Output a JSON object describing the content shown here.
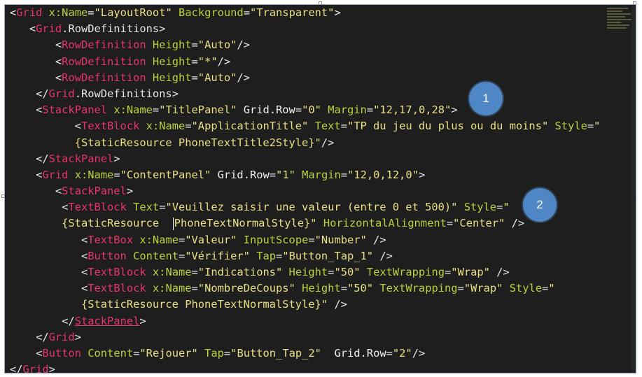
{
  "lines": [
    {
      "indent": "",
      "segs": [
        [
          "p",
          "<"
        ],
        [
          "t",
          "Grid"
        ],
        [
          "p",
          " "
        ],
        [
          "a",
          "x:Name"
        ],
        [
          "p",
          "="
        ],
        [
          "v",
          "\"LayoutRoot\""
        ],
        [
          "p",
          " "
        ],
        [
          "a",
          "Background"
        ],
        [
          "p",
          "="
        ],
        [
          "v",
          "\"Transparent\""
        ],
        [
          "p",
          ">"
        ]
      ]
    },
    {
      "indent": "   ",
      "segs": [
        [
          "p",
          "<"
        ],
        [
          "t",
          "Grid"
        ],
        [
          "p",
          ".RowDefinitions>"
        ]
      ]
    },
    {
      "indent": "       ",
      "segs": [
        [
          "p",
          "<"
        ],
        [
          "t",
          "RowDefinition"
        ],
        [
          "p",
          " "
        ],
        [
          "a",
          "Height"
        ],
        [
          "p",
          "="
        ],
        [
          "v",
          "\"Auto\""
        ],
        [
          "p",
          "/>"
        ]
      ]
    },
    {
      "indent": "       ",
      "segs": [
        [
          "p",
          "<"
        ],
        [
          "t",
          "RowDefinition"
        ],
        [
          "p",
          " "
        ],
        [
          "a",
          "Height"
        ],
        [
          "p",
          "="
        ],
        [
          "v",
          "\"*\""
        ],
        [
          "p",
          "/>"
        ]
      ]
    },
    {
      "indent": "       ",
      "segs": [
        [
          "p",
          "<"
        ],
        [
          "t",
          "RowDefinition"
        ],
        [
          "p",
          " "
        ],
        [
          "a",
          "Height"
        ],
        [
          "p",
          "="
        ],
        [
          "v",
          "\"Auto\""
        ],
        [
          "p",
          "/>"
        ]
      ]
    },
    {
      "indent": "    ",
      "segs": [
        [
          "p",
          "</"
        ],
        [
          "t",
          "Grid"
        ],
        [
          "p",
          ".RowDefinitions>"
        ]
      ]
    },
    {
      "indent": "    ",
      "segs": [
        [
          "p",
          "<"
        ],
        [
          "t",
          "StackPanel"
        ],
        [
          "p",
          " "
        ],
        [
          "a",
          "x:Name"
        ],
        [
          "p",
          "="
        ],
        [
          "v",
          "\"TitlePanel\""
        ],
        [
          "p",
          " "
        ],
        [
          "txt",
          "Grid.Row"
        ],
        [
          "p",
          "="
        ],
        [
          "v",
          "\"0\""
        ],
        [
          "p",
          " "
        ],
        [
          "a",
          "Margin"
        ],
        [
          "p",
          "="
        ],
        [
          "v",
          "\"12,17,0,28\""
        ],
        [
          "p",
          ">"
        ]
      ]
    },
    {
      "indent": "          ",
      "segs": [
        [
          "p",
          "<"
        ],
        [
          "t",
          "TextBlock"
        ],
        [
          "p",
          " "
        ],
        [
          "a",
          "x:Name"
        ],
        [
          "p",
          "="
        ],
        [
          "v",
          "\"ApplicationTitle\""
        ],
        [
          "p",
          " "
        ],
        [
          "a",
          "Text"
        ],
        [
          "p",
          "="
        ],
        [
          "v",
          "\"TP du jeu du plus ou du moins\""
        ],
        [
          "p",
          " "
        ],
        [
          "a",
          "Style"
        ],
        [
          "p",
          "="
        ],
        [
          "v",
          "\""
        ]
      ]
    },
    {
      "indent": "          ",
      "segs": [
        [
          "v",
          "{StaticResource PhoneTextTitle2Style}\""
        ],
        [
          "p",
          "/>"
        ]
      ]
    },
    {
      "indent": "    ",
      "segs": [
        [
          "p",
          "</"
        ],
        [
          "t",
          "StackPanel"
        ],
        [
          "p",
          ">"
        ]
      ]
    },
    {
      "indent": "    ",
      "segs": [
        [
          "p",
          "<"
        ],
        [
          "t",
          "Grid"
        ],
        [
          "p",
          " "
        ],
        [
          "a",
          "x:Name"
        ],
        [
          "p",
          "="
        ],
        [
          "v",
          "\"ContentPanel\""
        ],
        [
          "p",
          " "
        ],
        [
          "txt",
          "Grid.Row"
        ],
        [
          "p",
          "="
        ],
        [
          "v",
          "\"1\""
        ],
        [
          "p",
          " "
        ],
        [
          "a",
          "Margin"
        ],
        [
          "p",
          "="
        ],
        [
          "v",
          "\"12,0,12,0\""
        ],
        [
          "p",
          ">"
        ]
      ]
    },
    {
      "indent": "       ",
      "segs": [
        [
          "p",
          "<"
        ],
        [
          "t",
          "StackPanel"
        ],
        [
          "p",
          ">"
        ]
      ]
    },
    {
      "indent": "        ",
      "segs": [
        [
          "p",
          "<"
        ],
        [
          "t",
          "TextBlock"
        ],
        [
          "p",
          " "
        ],
        [
          "a",
          "Text"
        ],
        [
          "p",
          "="
        ],
        [
          "v",
          "\"Veuillez saisir une valeur (entre 0 et 500)\""
        ],
        [
          "p",
          " "
        ],
        [
          "a",
          "Style"
        ],
        [
          "p",
          "="
        ],
        [
          "v",
          "\""
        ]
      ]
    },
    {
      "indent": "        ",
      "segs": [
        [
          "v",
          "{StaticResource  "
        ],
        [
          "caret",
          ""
        ],
        [
          "v",
          "PhoneTextNormalStyle}\""
        ],
        [
          "p",
          " "
        ],
        [
          "a",
          "HorizontalAlignment"
        ],
        [
          "p",
          "="
        ],
        [
          "v",
          "\"Center\""
        ],
        [
          "p",
          " />"
        ]
      ]
    },
    {
      "indent": "           ",
      "segs": [
        [
          "p",
          "<"
        ],
        [
          "t",
          "TextBox"
        ],
        [
          "p",
          " "
        ],
        [
          "a",
          "x:Name"
        ],
        [
          "p",
          "="
        ],
        [
          "v",
          "\"Valeur\""
        ],
        [
          "p",
          " "
        ],
        [
          "a",
          "InputScope"
        ],
        [
          "p",
          "="
        ],
        [
          "v",
          "\"Number\""
        ],
        [
          "p",
          " />"
        ]
      ]
    },
    {
      "indent": "           ",
      "segs": [
        [
          "p",
          "<"
        ],
        [
          "t",
          "Button"
        ],
        [
          "p",
          " "
        ],
        [
          "a",
          "Content"
        ],
        [
          "p",
          "="
        ],
        [
          "v",
          "\"Vérifier\""
        ],
        [
          "p",
          " "
        ],
        [
          "a",
          "Tap"
        ],
        [
          "p",
          "="
        ],
        [
          "v",
          "\"Button_Tap_1\""
        ],
        [
          "p",
          " />"
        ]
      ]
    },
    {
      "indent": "           ",
      "segs": [
        [
          "p",
          "<"
        ],
        [
          "t",
          "TextBlock"
        ],
        [
          "p",
          " "
        ],
        [
          "a",
          "x:Name"
        ],
        [
          "p",
          "="
        ],
        [
          "v",
          "\"Indications\""
        ],
        [
          "p",
          " "
        ],
        [
          "a",
          "Height"
        ],
        [
          "p",
          "="
        ],
        [
          "v",
          "\"50\""
        ],
        [
          "p",
          " "
        ],
        [
          "a",
          "TextWrapping"
        ],
        [
          "p",
          "="
        ],
        [
          "v",
          "\"Wrap\""
        ],
        [
          "p",
          " />"
        ]
      ]
    },
    {
      "indent": "           ",
      "segs": [
        [
          "p",
          "<"
        ],
        [
          "t",
          "TextBlock"
        ],
        [
          "p",
          " "
        ],
        [
          "a",
          "x:Name"
        ],
        [
          "p",
          "="
        ],
        [
          "v",
          "\"NombreDeCoups\""
        ],
        [
          "p",
          " "
        ],
        [
          "a",
          "Height"
        ],
        [
          "p",
          "="
        ],
        [
          "v",
          "\"50\""
        ],
        [
          "p",
          " "
        ],
        [
          "a",
          "TextWrapping"
        ],
        [
          "p",
          "="
        ],
        [
          "v",
          "\"Wrap\""
        ],
        [
          "p",
          " "
        ],
        [
          "a",
          "Style"
        ],
        [
          "p",
          "="
        ],
        [
          "v",
          "\""
        ]
      ]
    },
    {
      "indent": "           ",
      "segs": [
        [
          "v",
          "{StaticResource PhoneTextNormalStyle}\""
        ],
        [
          "p",
          " />"
        ]
      ]
    },
    {
      "indent": "        ",
      "segs": [
        [
          "p",
          "</"
        ],
        [
          "tu",
          "StackPanel"
        ],
        [
          "p",
          ">"
        ]
      ]
    },
    {
      "indent": "    ",
      "segs": [
        [
          "p",
          "</"
        ],
        [
          "t",
          "Grid"
        ],
        [
          "p",
          ">"
        ]
      ]
    },
    {
      "indent": "    ",
      "segs": [
        [
          "p",
          "<"
        ],
        [
          "t",
          "Button"
        ],
        [
          "p",
          " "
        ],
        [
          "a",
          "Content"
        ],
        [
          "p",
          "="
        ],
        [
          "v",
          "\"Rejouer\""
        ],
        [
          "p",
          " "
        ],
        [
          "a",
          "Tap"
        ],
        [
          "p",
          "="
        ],
        [
          "v",
          "\"Button_Tap_2\""
        ],
        [
          "p",
          "  "
        ],
        [
          "txt",
          "Grid.Row"
        ],
        [
          "p",
          "="
        ],
        [
          "v",
          "\"2\""
        ],
        [
          "p",
          "/>"
        ]
      ]
    },
    {
      "indent": "",
      "segs": [
        [
          "p",
          "</"
        ],
        [
          "t",
          "Grid"
        ],
        [
          "p",
          ">"
        ]
      ]
    }
  ],
  "badges": [
    {
      "label": "1"
    },
    {
      "label": "2"
    }
  ],
  "colors": {
    "background": "#1e1e1e",
    "tag": "#e8336c",
    "attribute": "#b8d33a",
    "string": "#e8e082",
    "punctuation": "#e6e6e6",
    "badge": "#4f86c6"
  }
}
